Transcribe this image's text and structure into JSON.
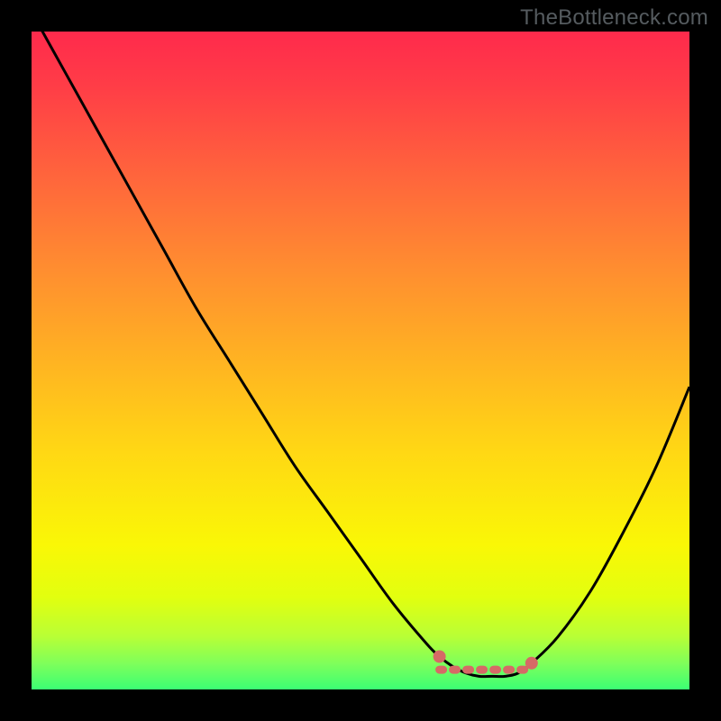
{
  "watermark": "TheBottleneck.com",
  "chart_data": {
    "type": "line",
    "title": "",
    "xlabel": "",
    "ylabel": "",
    "xlim": [
      0,
      100
    ],
    "ylim": [
      0,
      100
    ],
    "series": [
      {
        "name": "bottleneck-curve",
        "x": [
          0,
          5,
          10,
          15,
          20,
          25,
          30,
          35,
          40,
          45,
          50,
          55,
          60,
          62,
          64,
          66,
          68,
          70,
          72,
          74,
          76,
          80,
          85,
          90,
          95,
          100
        ],
        "values": [
          103,
          94,
          85,
          76,
          67,
          58,
          50,
          42,
          34,
          27,
          20,
          13,
          7,
          5,
          3.5,
          2.5,
          2,
          2,
          2,
          2.5,
          4,
          8,
          15,
          24,
          34,
          46
        ]
      }
    ],
    "markers": [
      {
        "name": "range-left-dot",
        "x": 62,
        "y": 5
      },
      {
        "name": "range-right-dot",
        "x": 76,
        "y": 4
      }
    ],
    "optimal_band": {
      "x_start": 62,
      "x_end": 76,
      "y": 3
    }
  },
  "colors": {
    "curve": "#000000",
    "marker": "#d66a66",
    "band": "#d66a66"
  }
}
